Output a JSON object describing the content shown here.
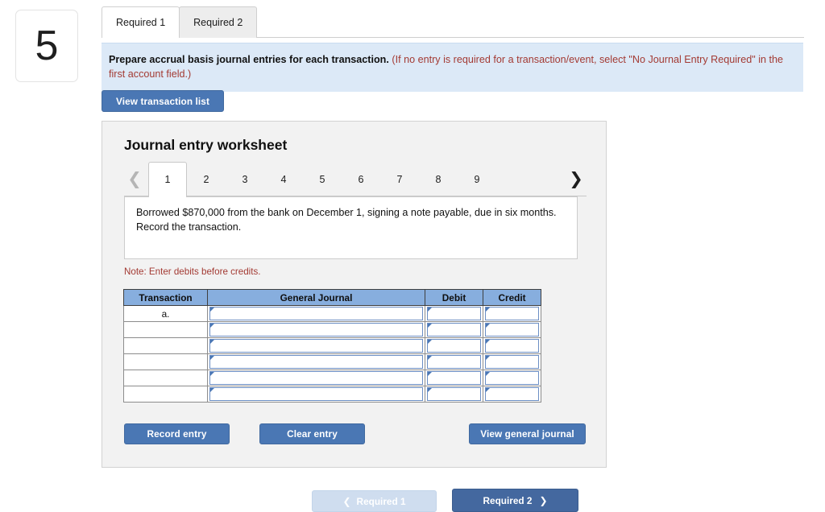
{
  "question_number": "5",
  "tabs": [
    {
      "label": "Required 1",
      "active": true
    },
    {
      "label": "Required 2",
      "active": false
    }
  ],
  "banner": {
    "main_text": "Prepare accrual basis journal entries for each transaction.",
    "hint_text": "(If no entry is required for a transaction/event, select \"No Journal Entry Required\" in the first account field.)"
  },
  "toolbar": {
    "view_transaction_list_label": "View transaction list"
  },
  "worksheet": {
    "title": "Journal entry worksheet",
    "pager": {
      "prev_icon": "chevron-left-icon",
      "next_icon": "chevron-right-icon",
      "pages": [
        "1",
        "2",
        "3",
        "4",
        "5",
        "6",
        "7",
        "8",
        "9"
      ],
      "active_page": "1"
    },
    "description": "Borrowed $870,000 from the bank on December 1, signing a note payable, due in six months. Record the transaction.",
    "note": "Note: Enter debits before credits.",
    "table": {
      "columns": [
        "Transaction",
        "General Journal",
        "Debit",
        "Credit"
      ],
      "rows": [
        {
          "transaction": "a.",
          "general_journal": "",
          "debit": "",
          "credit": ""
        },
        {
          "transaction": "",
          "general_journal": "",
          "debit": "",
          "credit": ""
        },
        {
          "transaction": "",
          "general_journal": "",
          "debit": "",
          "credit": ""
        },
        {
          "transaction": "",
          "general_journal": "",
          "debit": "",
          "credit": ""
        },
        {
          "transaction": "",
          "general_journal": "",
          "debit": "",
          "credit": ""
        },
        {
          "transaction": "",
          "general_journal": "",
          "debit": "",
          "credit": ""
        }
      ]
    },
    "actions": {
      "record_entry_label": "Record entry",
      "clear_entry_label": "Clear entry",
      "view_general_journal_label": "View general journal"
    }
  },
  "bottom_nav": {
    "prev_label": "Required 1",
    "prev_icon": "chevron-left-icon",
    "next_label": "Required 2",
    "next_icon": "chevron-right-icon"
  },
  "colors": {
    "accent_blue": "#4a77b4",
    "header_blue": "#87aede",
    "banner_blue": "#dce9f7",
    "note_red": "#a33a33",
    "card_gray": "#f2f2f2"
  }
}
